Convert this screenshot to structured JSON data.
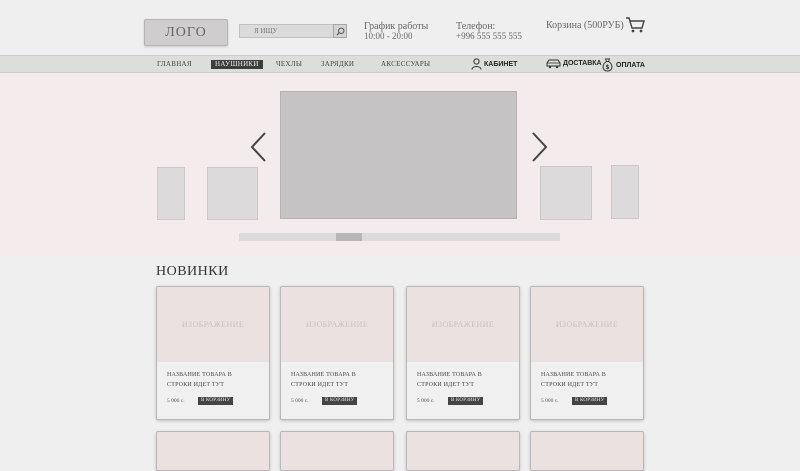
{
  "header": {
    "logo": "ЛОГО",
    "search_placeholder": "Я ИЩУ",
    "schedule_label": "График работы",
    "schedule_value": "10:00 - 20:00",
    "phone_label": "Телефон:",
    "phone_value": "+996 555 555 555",
    "cart_label": "Корзина (500РУБ)"
  },
  "nav": {
    "items": [
      "ГЛАВНАЯ",
      "НАУШНИКИ",
      "ЧЕХЛЫ",
      "ЗАРЯДКИ",
      "АКСЕССУАРЫ"
    ],
    "active_index": 1,
    "cabinet": "КАБИНЕТ",
    "delivery": "ДОСТАВКА",
    "payment": "ОПЛАТА"
  },
  "slider": {
    "position_fraction": 0.33
  },
  "section": {
    "title": "НОВИНКИ"
  },
  "products": [
    {
      "image_text": "ИЗОБРАЖЕНИЕ",
      "name_line1": "НАЗВАНИЕ ТОВАРА В",
      "name_line2": "СТРОКИ ИДЕТ ТУТ",
      "price": "5 000 с.",
      "button": "В КОРЗИНУ"
    },
    {
      "image_text": "ИЗОБРАЖЕНИЕ",
      "name_line1": "НАЗВАНИЕ ТОВАРА В",
      "name_line2": "СТРОКИ ИДЕТ ТУТ",
      "price": "5 000 с.",
      "button": "В КОРЗИНУ"
    },
    {
      "image_text": "ИЗОБРАЖЕНИЕ",
      "name_line1": "НАЗВАНИЕ ТОВАРА В",
      "name_line2": "СТРОКИ ИДЕТ ТУТ",
      "price": "5 000 с.",
      "button": "В КОРЗИНУ"
    },
    {
      "image_text": "ИЗОБРАЖЕНИЕ",
      "name_line1": "НАЗВАНИЕ ТОВАРА В",
      "name_line2": "СТРОКИ ИДЕТ ТУТ",
      "price": "5 000 с.",
      "button": "В КОРЗИНУ"
    }
  ],
  "colors": {
    "background": "#f0eff0",
    "nav_background": "#dcdedb",
    "slider_background": "#f4ecec",
    "button_dark": "#444444",
    "image_placeholder": "#ebe1e1"
  }
}
